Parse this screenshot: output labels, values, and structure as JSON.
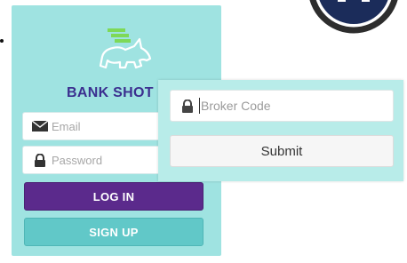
{
  "app": {
    "brand_name": "BANK SHOT",
    "colors": {
      "card_background": "#9fe3e1",
      "brand_text": "#3b2f8f",
      "login_button": "#5b2a8c",
      "signup_button": "#61c8c8",
      "logo_green": "#7ed957",
      "overlay_background": "#b8ece9"
    }
  },
  "login_form": {
    "email": {
      "placeholder": "Email",
      "value": "",
      "icon": "envelope-icon"
    },
    "password": {
      "placeholder": "Password",
      "value": "",
      "icon": "lock-icon"
    },
    "login_label": "LOG IN",
    "signup_label": "SIGN UP"
  },
  "broker_form": {
    "broker_code": {
      "placeholder": "Broker Code",
      "value": "",
      "icon": "lock-icon"
    },
    "submit_label": "Submit"
  }
}
